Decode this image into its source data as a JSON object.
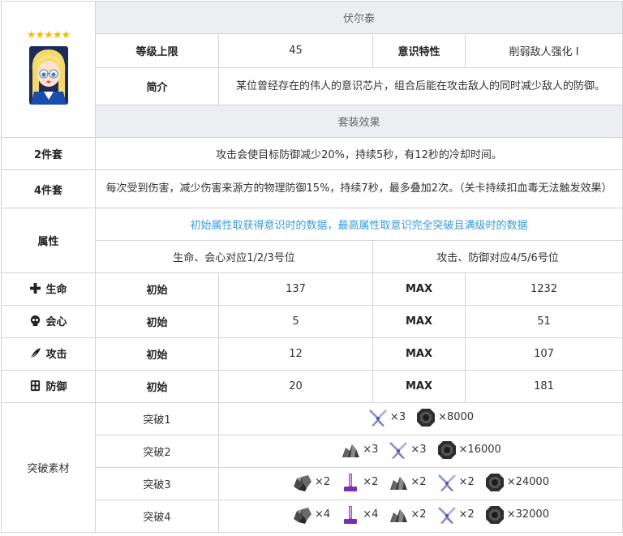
{
  "rarity": "★★★★★",
  "name": "伏尔泰",
  "info": {
    "level_cap_label": "等级上限",
    "level_cap_value": "45",
    "trait_label": "意识特性",
    "trait_value": "削弱敌人强化 I",
    "intro_label": "简介",
    "intro_value": "某位曾经存在的伟人的意识芯片，组合后能在攻击敌人的同时减少敌人的防御。"
  },
  "set_effects": {
    "header": "套装效果",
    "two_label": "2件套",
    "two_value": "攻击会使目标防御减少20%，持续5秒，有12秒的冷却时间。",
    "four_label": "4件套",
    "four_value": "每次受到伤害，减少伤害来源方的物理防御15%，持续7秒，最多叠加2次。（关卡持续扣血毒无法触发效果）"
  },
  "attributes": {
    "label": "属性",
    "note": "初始属性取获得意识时的数据，最高属性取意识完全突破且满级时的数据",
    "left_header": "生命、会心对应1/2/3号位",
    "right_header": "攻击、防御对应4/5/6号位",
    "init_label": "初始",
    "max_label": "MAX",
    "rows": [
      {
        "name": "生命",
        "icon": "plus-icon",
        "init": "137",
        "max": "1232"
      },
      {
        "name": "会心",
        "icon": "skull-icon",
        "init": "5",
        "max": "51"
      },
      {
        "name": "攻击",
        "icon": "feather-icon",
        "init": "12",
        "max": "107"
      },
      {
        "name": "防御",
        "icon": "shield-block-icon",
        "init": "20",
        "max": "181"
      }
    ]
  },
  "breakthrough": {
    "label": "突破素材",
    "rows": [
      {
        "name": "突破1",
        "items": [
          {
            "icon": "crystal-blade-icon",
            "qty": "×3"
          },
          {
            "icon": "coin-icon",
            "qty": "×8000"
          }
        ]
      },
      {
        "name": "突破2",
        "items": [
          {
            "icon": "ore-icon",
            "qty": "×3"
          },
          {
            "icon": "crystal-blade-icon",
            "qty": "×3"
          },
          {
            "icon": "coin-icon",
            "qty": "×16000"
          }
        ]
      },
      {
        "name": "突破3",
        "items": [
          {
            "icon": "rock-icon",
            "qty": "×2"
          },
          {
            "icon": "purple-tool-icon",
            "qty": "×2"
          },
          {
            "icon": "ore-icon",
            "qty": "×2"
          },
          {
            "icon": "crystal-blade-icon",
            "qty": "×2"
          },
          {
            "icon": "coin-icon",
            "qty": "×24000"
          }
        ]
      },
      {
        "name": "突破4",
        "items": [
          {
            "icon": "rock-icon",
            "qty": "×4"
          },
          {
            "icon": "purple-tool-icon",
            "qty": "×4"
          },
          {
            "icon": "ore-icon",
            "qty": "×2"
          },
          {
            "icon": "crystal-blade-icon",
            "qty": "×2"
          },
          {
            "icon": "coin-icon",
            "qty": "×32000"
          }
        ]
      }
    ]
  }
}
